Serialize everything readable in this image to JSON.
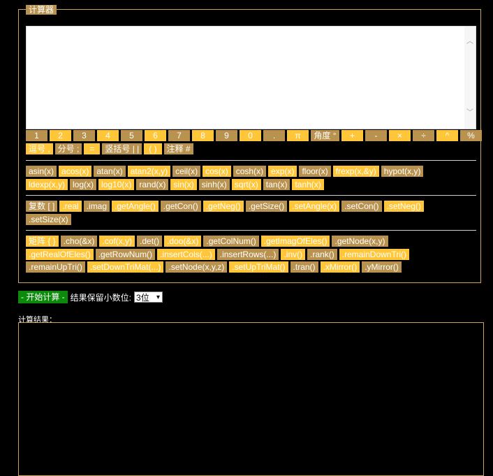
{
  "calculator": {
    "legend": "计算器",
    "keypad_row1": [
      "1",
      "2",
      "3",
      "4",
      "5",
      "6",
      "7",
      "8",
      "9",
      "0",
      ".",
      "π",
      "角度 °",
      "+",
      "-",
      "×",
      "÷",
      "^",
      "%"
    ],
    "keypad_row2": [
      "逗号 ,",
      "分号 ;",
      "=",
      "竖括号 | |",
      "( )",
      "注释 #"
    ],
    "functions": [
      "asin(x)",
      "acos(x)",
      "atan(x)",
      "atan2(x,y)",
      "ceil(x)",
      "cos(x)",
      "cosh(x)",
      "exp(x)",
      "floor(x)",
      "frexp(x,&y)",
      "hypot(x,y)",
      "ldexp(x,y)",
      "log(x)",
      "log10(x)",
      "rand(x)",
      "sin(x)",
      "sinh(x)",
      "sqrt(x)",
      "tan(x)",
      "tanh(x)"
    ],
    "complex_label": "复数 [ ]",
    "complex": [
      ".real",
      ".imag",
      ".getAngle()",
      ".getCon()",
      ".getNeg()",
      ".getSize()",
      ".setAngle(x)",
      ".setCon()",
      ".setNeg()",
      ".setSize(x)"
    ],
    "matrix_label": "矩阵 { }",
    "matrix": [
      ".cho(&x)",
      ".cof(x,y)",
      ".det()",
      ".doo(&x)",
      ".getColNum()",
      ".getImagOfEles()",
      ".getNode(x,y)",
      ".getRealOfEles()",
      ".getRowNum()",
      ".insertCols(...)",
      ".insertRows(...)",
      ".inv()",
      ".rank()",
      ".remainDownTri()",
      ".remainUpTri()",
      ".setDownTriMat(...)",
      ".setNode(x,y,z)",
      ".setUpTriMat()",
      ".tran()",
      ".xMirror()",
      ".yMirror()"
    ]
  },
  "controls": {
    "start_label": "- 开始计算 -",
    "decimals_label": "结果保留小数位:",
    "decimals_value": "3位"
  },
  "result": {
    "label": "计算结果："
  },
  "colors": {
    "accent_yellow": "#ffc63a",
    "accent_brown": "#b8924e",
    "start_green": "#0b8a0b",
    "border": "#c9a463"
  }
}
